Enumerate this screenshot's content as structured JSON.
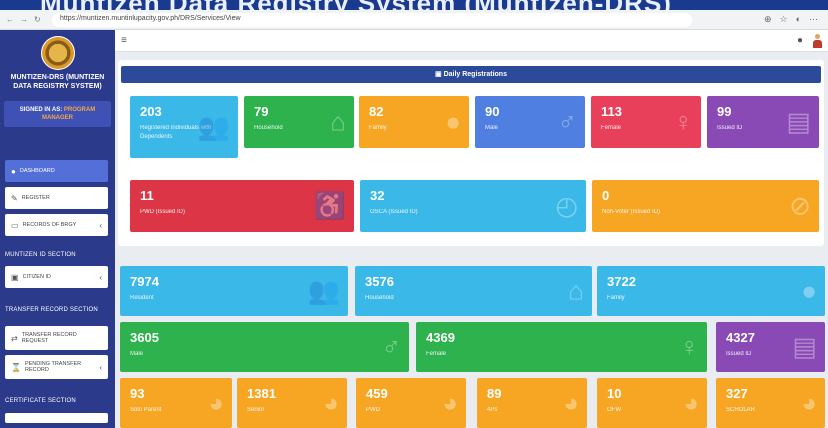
{
  "banner": {
    "text": "Muntizen Data Registry System (Muntizen-DRS)"
  },
  "browser": {
    "url": "https://muntizen.muntinlupacity.gov.ph/DRS/Services/View"
  },
  "sidebar": {
    "app_name": "MUNTIZEN-DRS (MUNTIZEN DATA REGISTRY SYSTEM)",
    "signed_in_prefix": "SIGNED IN AS:",
    "role": "PROGRAM MANAGER",
    "items": [
      {
        "label": "DASHBOARD",
        "icon": "dashboard-icon"
      },
      {
        "label": "REGISTER",
        "icon": "edit-icon"
      },
      {
        "label": "RECORDS OF BRGY",
        "icon": "folder-icon"
      },
      {
        "label": "CITIZEN ID",
        "icon": "id-card-icon"
      },
      {
        "label": "TRANSFER RECORD REQUEST",
        "icon": "transfer-icon"
      },
      {
        "label": "PENDING TRANSFER RECORD",
        "icon": "hourglass-icon"
      }
    ],
    "sections": [
      "MUNTIZEN ID SECTION",
      "TRANSFER RECORD SECTION",
      "CERTIFICATE SECTION"
    ]
  },
  "topbar": {
    "menu_icon": "menu-icon",
    "bell_icon": "bell-icon",
    "user_icon": "user-avatar-icon"
  },
  "daily": {
    "title": "Daily Registrations",
    "cards": [
      {
        "value": "203",
        "label": "Registered Individuals with Dependents",
        "color": "#3ab8e8",
        "icon": "users-icon"
      },
      {
        "value": "79",
        "label": "Household",
        "color": "#2eb24e",
        "icon": "house-icon"
      },
      {
        "value": "82",
        "label": "Family",
        "color": "#f6a623",
        "icon": "user-icon"
      },
      {
        "value": "90",
        "label": "Male",
        "color": "#4f7fe0",
        "icon": "male-icon"
      },
      {
        "value": "113",
        "label": "Female",
        "color": "#e8405a",
        "icon": "female-icon"
      },
      {
        "value": "99",
        "label": "Issued ID",
        "color": "#8a4ab5",
        "icon": "id-card-icon"
      },
      {
        "value": "11",
        "label": "PWD (Issued ID)",
        "color": "#dc3545",
        "icon": "wheelchair-icon"
      },
      {
        "value": "32",
        "label": "OSCA (Issued ID)",
        "color": "#3ab8e8",
        "icon": "senior-icon"
      },
      {
        "value": "0",
        "label": "Non-Voter (Issued ID)",
        "color": "#f6a623",
        "icon": "no-voter-icon"
      }
    ]
  },
  "totals": [
    {
      "value": "7974",
      "label": "Resident",
      "color": "#3ab8e8",
      "icon": "users-icon"
    },
    {
      "value": "3576",
      "label": "Household",
      "color": "#3ab8e8",
      "icon": "house-icon"
    },
    {
      "value": "3722",
      "label": "Family",
      "color": "#3ab8e8",
      "icon": "user-icon"
    },
    {
      "value": "3605",
      "label": "Male",
      "color": "#2eb24e",
      "icon": "male-icon"
    },
    {
      "value": "4369",
      "label": "Female",
      "color": "#2eb24e",
      "icon": "female-icon"
    },
    {
      "value": "4327",
      "label": "Issued ID",
      "color": "#8a4ab5",
      "icon": "id-card-icon"
    }
  ],
  "sectors": [
    {
      "value": "93",
      "label": "Solo Parent",
      "color": "#f6a623",
      "icon": "pie-icon"
    },
    {
      "value": "1381",
      "label": "Senior",
      "color": "#f6a623",
      "icon": "pie-icon"
    },
    {
      "value": "459",
      "label": "PWD",
      "color": "#f6a623",
      "icon": "pie-icon"
    },
    {
      "value": "89",
      "label": "4Ps",
      "color": "#f6a623",
      "icon": "pie-icon"
    },
    {
      "value": "10",
      "label": "OFW",
      "color": "#f6a623",
      "icon": "pie-icon"
    },
    {
      "value": "327",
      "label": "SCHOLAR",
      "color": "#f6a623",
      "icon": "pie-icon"
    }
  ]
}
